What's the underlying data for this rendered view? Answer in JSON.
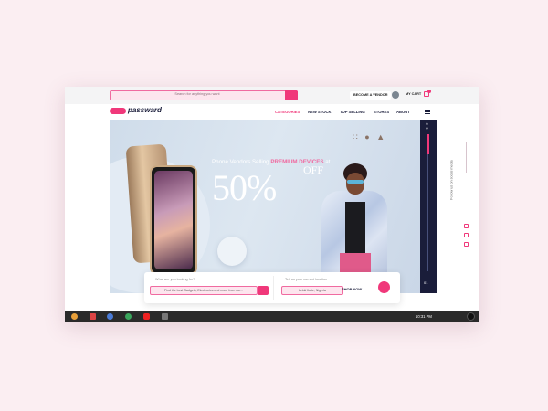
{
  "header": {
    "search_placeholder": "Search for anything you want",
    "vendor_label": "BECOME A VENDOR",
    "cart_label": "MY CART",
    "cart_count": "0"
  },
  "nav": {
    "logo_text": "passward",
    "items": [
      {
        "label": "CATEGORIES"
      },
      {
        "label": "NEW STOCK"
      },
      {
        "label": "TOP SELLING"
      },
      {
        "label": "STORES"
      },
      {
        "label": "ABOUT"
      }
    ]
  },
  "hero": {
    "line1_prefix": "Phone Vendors Selling",
    "line1_highlight": "PREMIUM DEVICES",
    "line1_suffix": "at",
    "discount": "50%",
    "off": "OFF",
    "slide_number": "01"
  },
  "rail": {
    "text": "Follow us on social media"
  },
  "search_panel": {
    "what_label": "What are you looking for?",
    "what_value": "Find the best Gadgets, Electronics and more from our...",
    "location_label": "Tell us your current location",
    "location_value": "Lekki Ikate, Nigeria",
    "shop_label": "SHOP NOW"
  },
  "taskbar": {
    "time": "10:31 PM"
  },
  "colors": {
    "accent": "#f0387a",
    "navy": "#1a1d3a"
  }
}
